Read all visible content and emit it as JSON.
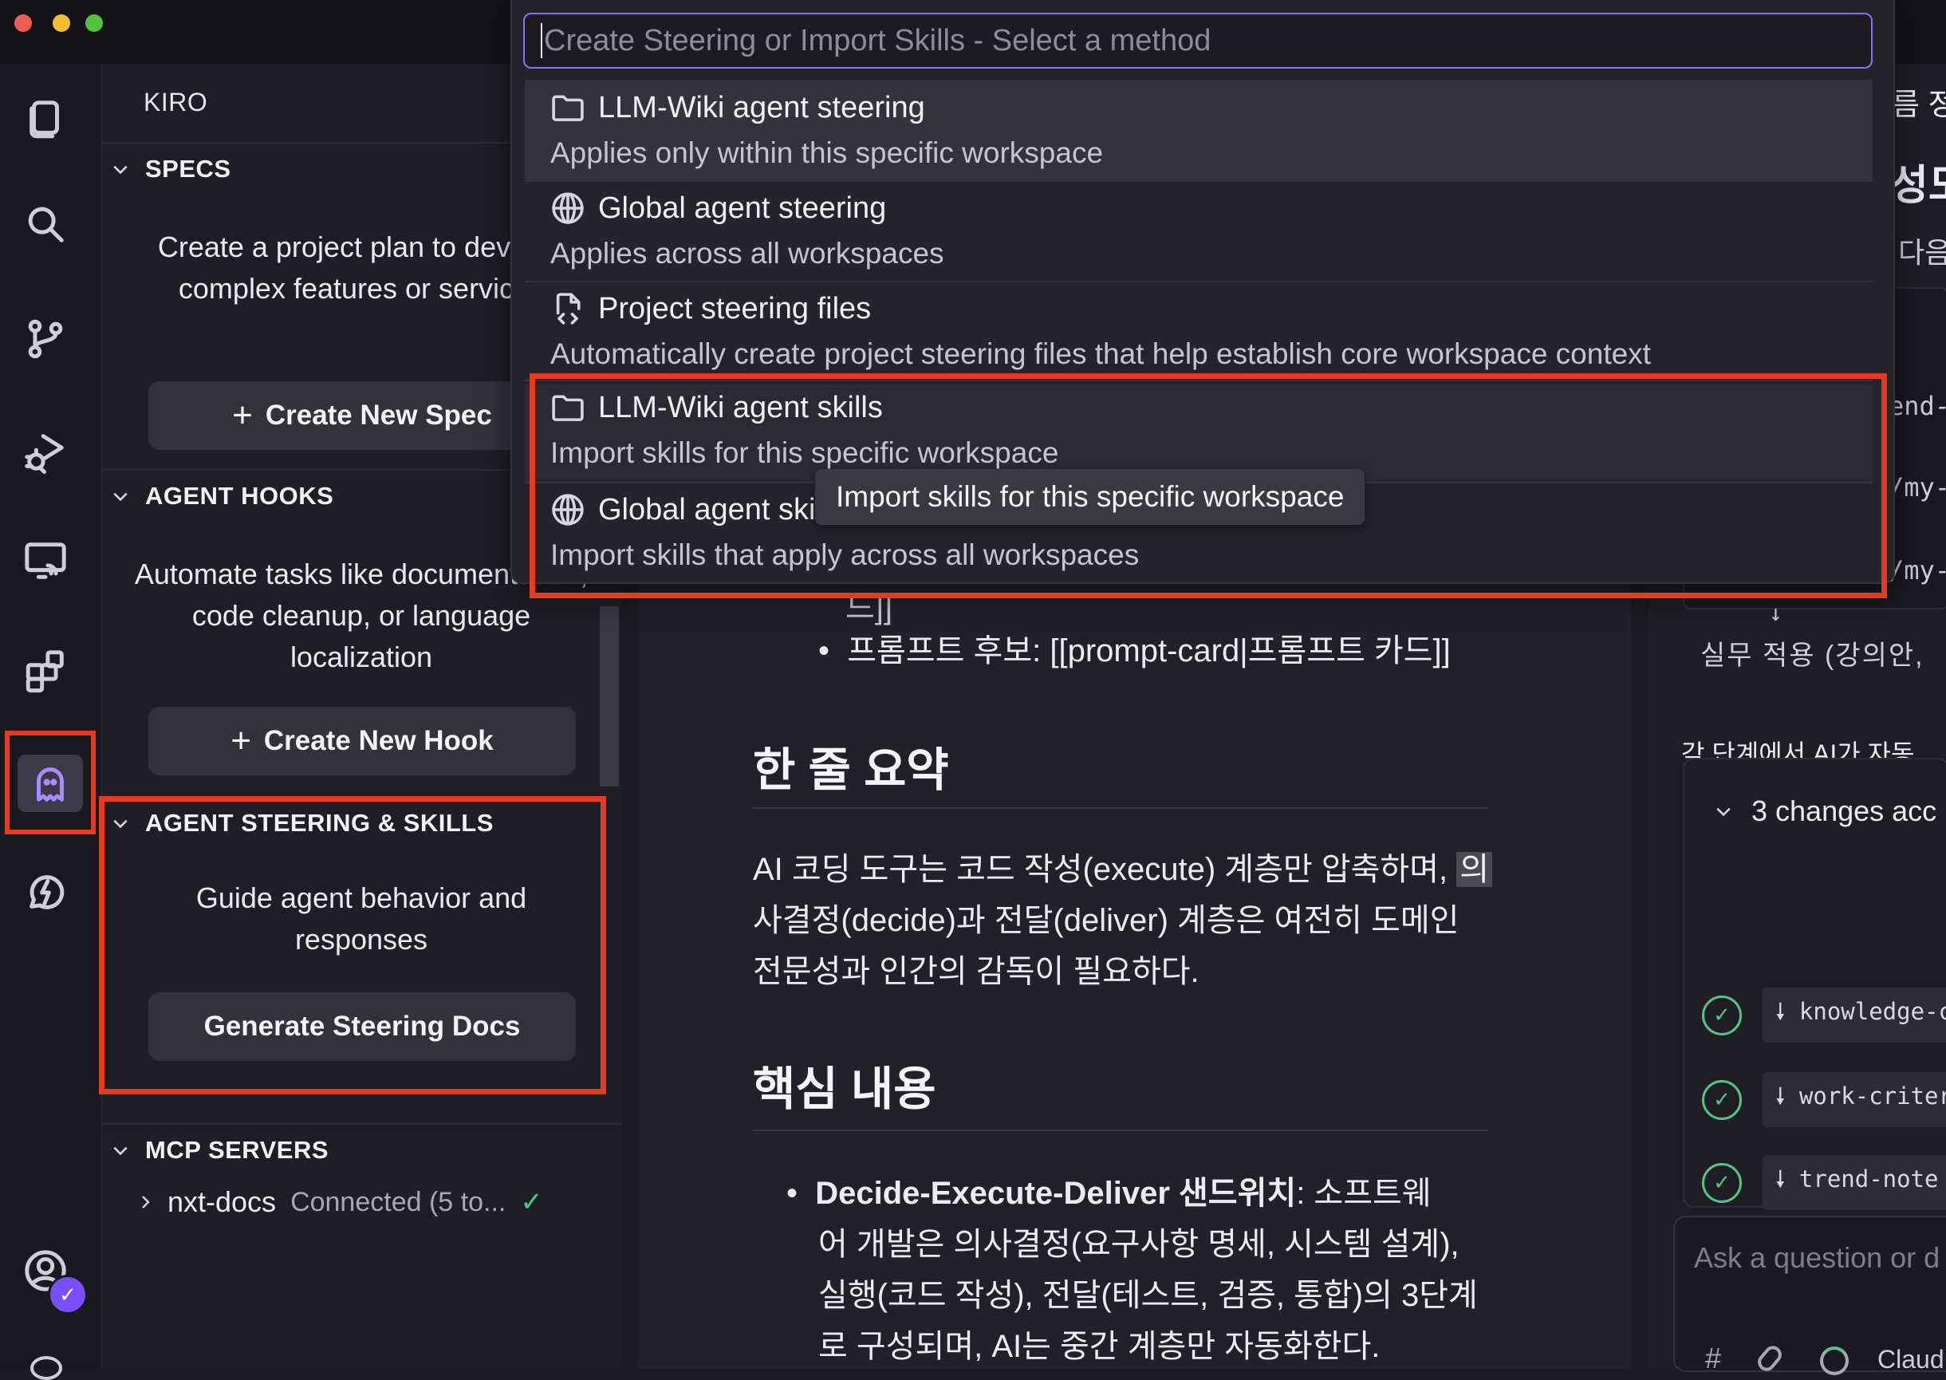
{
  "window": {
    "traffic_lights": [
      {
        "name": "close",
        "color": "#ee5d55"
      },
      {
        "name": "minimize",
        "color": "#f4be33"
      },
      {
        "name": "zoom",
        "color": "#54c03f"
      }
    ]
  },
  "activity_bar": {
    "icons": [
      "explorer-icon",
      "search-icon",
      "source-control-icon",
      "run-debug-icon",
      "remote-explorer-icon",
      "extensions-icon",
      "kiro-ghost-icon",
      "spark-chat-icon",
      "account-icon"
    ],
    "active": "kiro-ghost-icon"
  },
  "side_panel": {
    "title": "KIRO",
    "specs": {
      "header": "SPECS",
      "description": "Create a project plan to develop complex features or services",
      "button": "Create New Spec"
    },
    "hooks": {
      "header": "AGENT HOOKS",
      "description": "Automate tasks like documentation, code cleanup, or language localization",
      "button": "Create New Hook"
    },
    "steering": {
      "header": "AGENT STEERING & SKILLS",
      "description": "Guide agent behavior and responses",
      "button": "Generate Steering Docs"
    },
    "mcp": {
      "header": "MCP SERVERS",
      "server_name": "nxt-docs",
      "server_status": "Connected (5 to..."
    }
  },
  "quick_pick": {
    "placeholder": "Create Steering or Import Skills - Select a method",
    "items": [
      {
        "icon": "folder-icon",
        "title": "LLM-Wiki agent steering",
        "description": "Applies only within this specific workspace"
      },
      {
        "icon": "globe-icon",
        "title": "Global agent steering",
        "description": "Applies across all workspaces"
      },
      {
        "icon": "file-code-icon",
        "title": "Project steering files",
        "description": "Automatically create project steering files that help establish core workspace context"
      },
      {
        "icon": "folder-icon",
        "title": "LLM-Wiki agent skills",
        "description": "Import skills for this specific workspace"
      },
      {
        "icon": "globe-icon",
        "title": "Global agent ski",
        "description": "Import skills that apply across all workspaces"
      }
    ],
    "tooltip": "Import skills for this specific workspace"
  },
  "editor": {
    "fragment_top": "드]]",
    "bullet_prompt": "프롬프트 후보: [[prompt-card|프롬프트 카드]]",
    "summary_heading": "한 줄 요약",
    "summary_lines": [
      "AI 코딩 도구는 코드 작성(execute) 계층만 압축하며,",
      "의",
      "사결정(decide)과 전달(deliver) 계층은 여전히 도메인",
      "전문성과 인간의 감독이 필요하다."
    ],
    "core_heading": "핵심 내용",
    "bullet_bold": "Decide-Execute-Deliver 샌드위치",
    "bullet_lines": [
      ": 소프트웨",
      "어 개발은 의사결정(요구사항 명세, 시스템 설계),",
      "실행(코드 작성), 전달(테스트, 검증, 통합)의 3단계",
      "로 구성되며, AI는 중간 계층만 자동화한다."
    ]
  },
  "right_panel": {
    "top_fragment": "름 정",
    "heading_fragment": "성도",
    "text_fragment": "다음",
    "code_fragments": [
      "end-",
      "/my-",
      "/my-"
    ],
    "arrow": "↓",
    "apply_line": "실무 적용 (강의안,",
    "step_line": "각 단계에서 AI가 자동",
    "changes_label": "3 changes acc",
    "files": [
      "knowledge-c",
      "work-criter",
      "trend-note"
    ],
    "ask_placeholder": "Ask a question or d",
    "hash": "#",
    "model": "Claud"
  },
  "colors": {
    "accent": "#8f6ef2",
    "highlight_border": "#e63b23",
    "success": "#56c48a",
    "badge": "#7c4dff"
  }
}
